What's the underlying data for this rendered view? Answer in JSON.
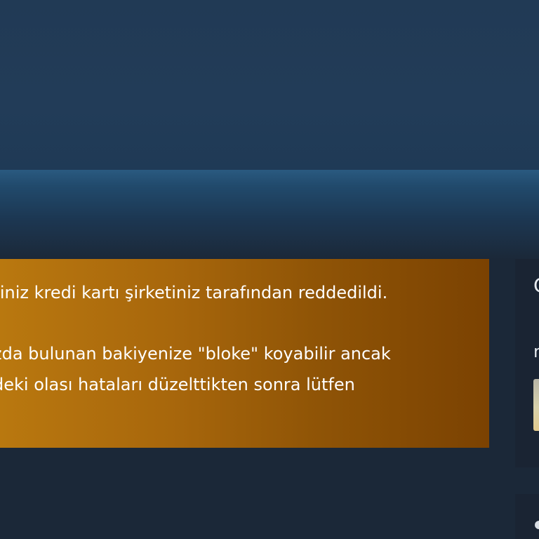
{
  "error": {
    "line1": "riniz kredi kartı şirketiniz tarafından reddedildi.",
    "line2": "zda bulunan bakiyenize \"bloke\" koyabilir ancak",
    "line3": "deki olası hataları düzelttikten sonra lütfen"
  },
  "side": {
    "heading": "C",
    "subtext": "n"
  },
  "colors": {
    "page_background": "#1b2838",
    "header_background": "#213a55",
    "banner_start": "#b9780f",
    "banner_end": "#7b4202",
    "side_panel": "#1a2433"
  }
}
